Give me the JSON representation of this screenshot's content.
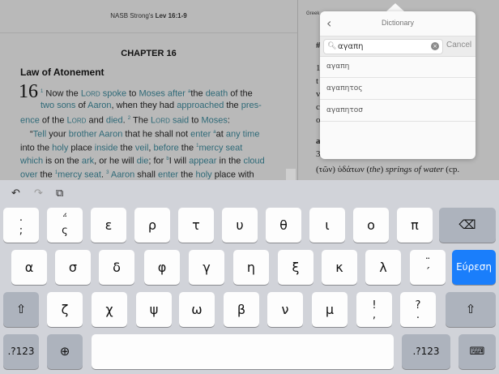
{
  "left_pane": {
    "header_prefix": "NASB Strong's ",
    "header_reference": "Lev 16:1-9",
    "chapter_title": "CHAPTER 16",
    "section_heading": "Law of Atonement",
    "verse_number": "16"
  },
  "right_pane": {
    "header": "Greek"
  },
  "dictionary": {
    "title": "Dictionary",
    "search_value": "αγαπη",
    "cancel_label": "Cancel",
    "results": [
      "αγαπη",
      "αγαπητος",
      "αγαπητοσ"
    ]
  },
  "keyboard": {
    "row1": [
      ";",
      "ς",
      "ε",
      "ρ",
      "τ",
      "υ",
      "θ",
      "ι",
      "ο",
      "π"
    ],
    "row2": [
      "α",
      "σ",
      "δ",
      "φ",
      "γ",
      "η",
      "ξ",
      "κ",
      "λ"
    ],
    "row3": [
      "ζ",
      "χ",
      "ψ",
      "ω",
      "β",
      "ν",
      "μ"
    ],
    "search_key": "Εύρεση",
    "numbers_key": ".?123",
    "numbers_key_right": ".?123",
    "row2_last_top": "¨",
    "row2_last_bottom": "΄",
    "row1_second_top": "΅",
    "row3_excl_top": "!",
    "row3_excl_bottom": ",",
    "row3_q_top": "?",
    "row3_q_bottom": "."
  },
  "icons": {
    "undo": "undo-icon",
    "redo": "redo-icon",
    "paste": "paste-icon",
    "backspace": "backspace-icon",
    "shift": "shift-icon",
    "globe": "globe-icon",
    "hide_keyboard": "keyboard-hide-icon"
  },
  "colors": {
    "link_teal": "#2f6a78",
    "search_blue": "#1a7efb",
    "keyboard_bg": "#d1d3d9"
  }
}
